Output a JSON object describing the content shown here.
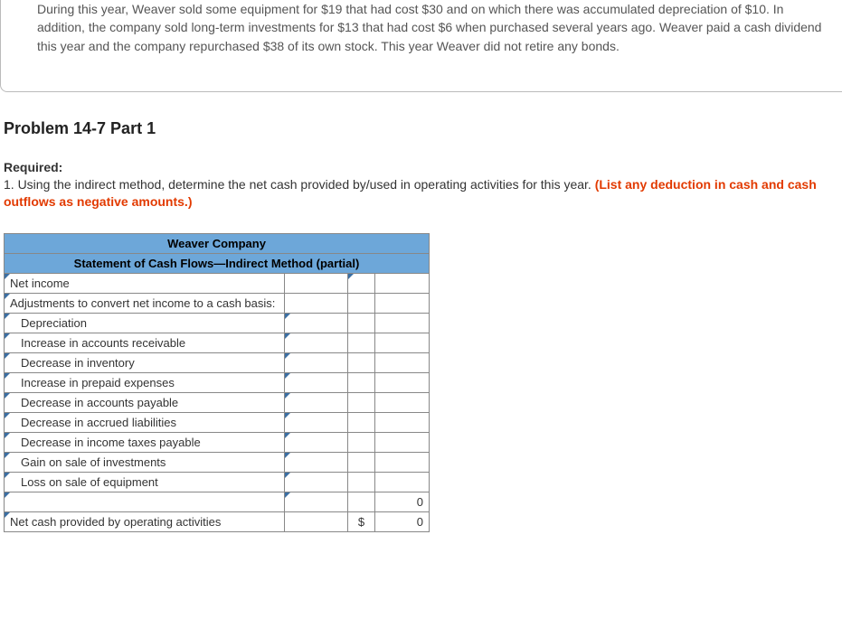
{
  "intro": "During this year, Weaver sold some equipment for $19 that had cost $30 and on which there was accumulated depreciation of $10. In addition, the company sold long-term investments for $13 that had cost $6 when purchased several years ago. Weaver paid a cash dividend this year and the company repurchased $38 of its own stock. This year Weaver did not retire any bonds.",
  "problem_heading": "Problem 14-7 Part 1",
  "required_label": "Required:",
  "required_text_pre": "1. Using the indirect method, determine the net cash provided by/used in operating activities for this year. ",
  "required_text_red": "(List any deduction in cash and cash outflows as negative amounts.)",
  "table": {
    "title1": "Weaver Company",
    "title2": "Statement of Cash Flows—Indirect Method (partial)",
    "rows": {
      "net_income": "Net income",
      "adjustments": "Adjustments to convert net income to a cash basis:",
      "depreciation": "Depreciation",
      "inc_ar": "Increase in accounts receivable",
      "dec_inv": "Decrease in inventory",
      "inc_prepaid": "Increase in prepaid expenses",
      "dec_ap": "Decrease in accounts payable",
      "dec_accrued": "Decrease in accrued liabilities",
      "dec_tax": "Decrease in income taxes payable",
      "gain_inv": "Gain on sale of investments",
      "loss_equip": "Loss on sale of equipment",
      "net_cash": "Net cash provided by operating activities"
    },
    "subtotal_value": "0",
    "dollar_sign": "$",
    "total_value": "0"
  }
}
